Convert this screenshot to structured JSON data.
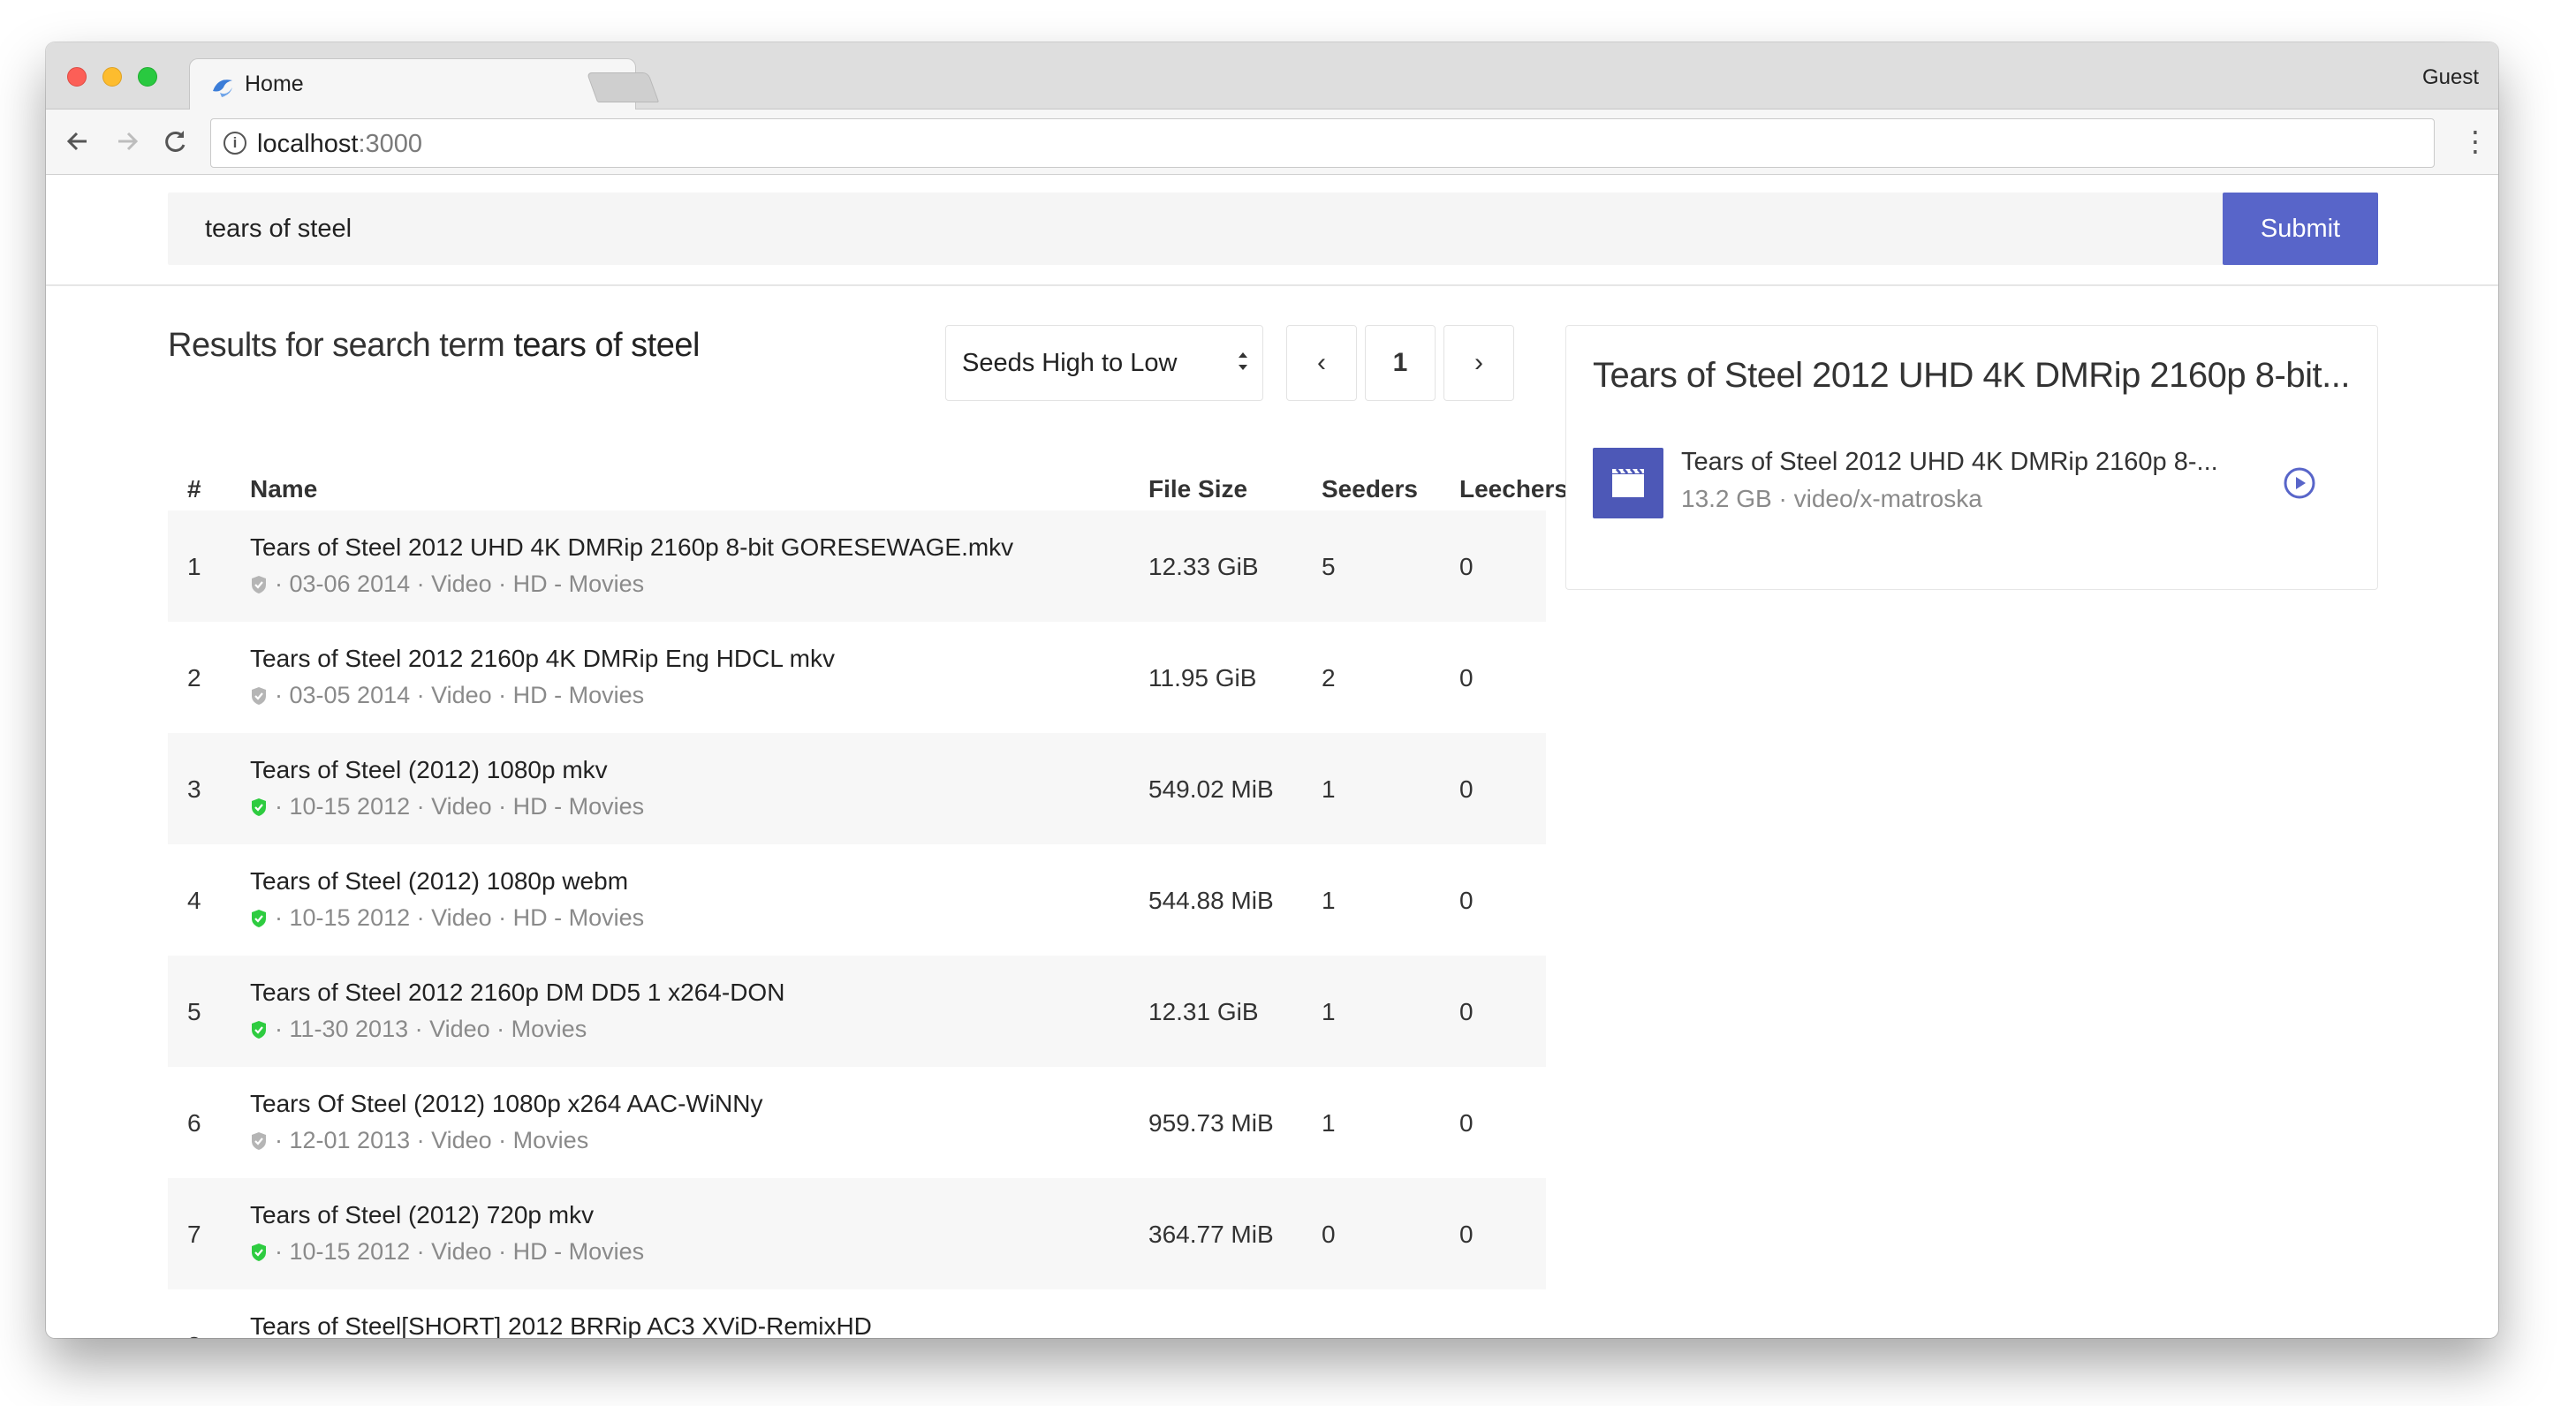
{
  "browser": {
    "tab_title": "Home",
    "tab_close": "×",
    "profile": "Guest",
    "url_host": "localhost",
    "url_port": ":3000",
    "info_glyph": "i",
    "menu_glyph": "⋮"
  },
  "search": {
    "value": "tears of steel",
    "submit_label": "Submit"
  },
  "results": {
    "heading_prefix": "Results for search term ",
    "heading_term": "tears of steel",
    "sort_selected": "Seeds High to Low",
    "pagination": {
      "prev": "‹",
      "page": "1",
      "next": "›"
    }
  },
  "table": {
    "headers": {
      "num": "#",
      "name": "Name",
      "size": "File Size",
      "seeders": "Seeders",
      "leechers": "Leechers"
    },
    "rows": [
      {
        "num": "1",
        "name": "Tears of Steel 2012 UHD 4K DMRip 2160p 8-bit GORESEWAGE.mkv",
        "meta": "· 03-06 2014 · Video · HD - Movies",
        "verified": false,
        "size": "12.33 GiB",
        "seeders": "5",
        "leechers": "0"
      },
      {
        "num": "2",
        "name": "Tears of Steel 2012 2160p 4K DMRip Eng HDCL mkv",
        "meta": "· 03-05 2014 · Video · HD - Movies",
        "verified": false,
        "size": "11.95 GiB",
        "seeders": "2",
        "leechers": "0"
      },
      {
        "num": "3",
        "name": "Tears of Steel (2012) 1080p mkv",
        "meta": "· 10-15 2012 · Video · HD - Movies",
        "verified": true,
        "size": "549.02 MiB",
        "seeders": "1",
        "leechers": "0"
      },
      {
        "num": "4",
        "name": "Tears of Steel (2012) 1080p webm",
        "meta": "· 10-15 2012 · Video · HD - Movies",
        "verified": true,
        "size": "544.88 MiB",
        "seeders": "1",
        "leechers": "0"
      },
      {
        "num": "5",
        "name": "Tears of Steel 2012 2160p DM DD5 1 x264-DON",
        "meta": "· 11-30 2013 · Video · Movies",
        "verified": true,
        "size": "12.31 GiB",
        "seeders": "1",
        "leechers": "0"
      },
      {
        "num": "6",
        "name": "Tears Of Steel (2012) 1080p x264 AAC-WiNNy",
        "meta": "· 12-01 2013 · Video · Movies",
        "verified": false,
        "size": "959.73 MiB",
        "seeders": "1",
        "leechers": "0"
      },
      {
        "num": "7",
        "name": "Tears of Steel (2012) 720p mkv",
        "meta": "· 10-15 2012 · Video · HD - Movies",
        "verified": true,
        "size": "364.77 MiB",
        "seeders": "0",
        "leechers": "0"
      },
      {
        "num": "8",
        "name": "Tears of Steel[SHORT] 2012 BRRip AC3 XViD-RemixHD",
        "meta": "",
        "verified": false,
        "size": "",
        "seeders": "",
        "leechers": ""
      }
    ]
  },
  "panel": {
    "title": "Tears of Steel 2012 UHD 4K DMRip 2160p 8-bit...",
    "file_name": "Tears of Steel 2012 UHD 4K DMRip 2160p 8-...",
    "file_meta": "13.2 GB · video/x-matroska",
    "icon": "film-icon",
    "action_icon": "play-circle-icon"
  },
  "colors": {
    "accent": "#5865c9",
    "verified": "#2ecc40",
    "unverified": "#b5b5b5"
  }
}
